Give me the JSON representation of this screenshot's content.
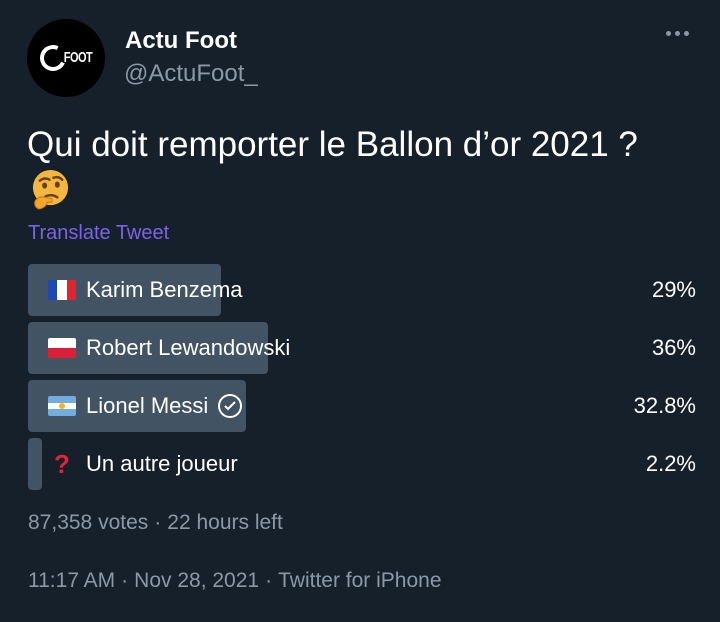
{
  "author": {
    "display_name": "Actu Foot",
    "handle": "@ActuFoot_",
    "avatar_text": "FOOT"
  },
  "tweet": {
    "text": "Qui doit remporter le Ballon d’or 2021 ?",
    "emoji": "thinking-face-icon",
    "translate_label": "Translate Tweet"
  },
  "poll": {
    "options": [
      {
        "label": "Karim Benzema",
        "percent": "29%",
        "fraction": 0.29,
        "icon": "france-flag-icon"
      },
      {
        "label": "Robert Lewandowski",
        "percent": "36%",
        "fraction": 0.36,
        "icon": "poland-flag-icon"
      },
      {
        "label": "Lionel Messi",
        "percent": "32.8%",
        "fraction": 0.328,
        "icon": "argentina-flag-icon",
        "selected_icon": "check-circle-icon"
      },
      {
        "label": "Un autre joueur",
        "percent": "2.2%",
        "fraction": 0.022,
        "icon": "question-mark-icon"
      }
    ],
    "votes": "87,358 votes",
    "time_left": "22 hours left",
    "separator": "·"
  },
  "meta": {
    "time": "11:17 AM",
    "date": "Nov 28, 2021",
    "source": "Twitter for iPhone",
    "separator": "·"
  },
  "colors": {
    "background": "#15202b",
    "text_secondary": "#8b98a5",
    "poll_bar": "#425364",
    "translate_link": "#7a63e6"
  }
}
